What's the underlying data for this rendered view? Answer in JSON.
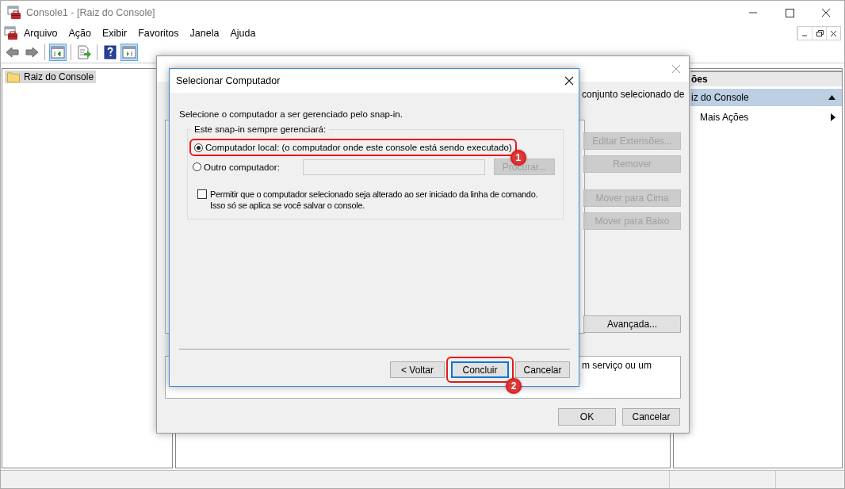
{
  "window": {
    "title": "Console1 - [Raiz do Console]"
  },
  "menu": [
    {
      "label": "Arquivo"
    },
    {
      "label": "Ação"
    },
    {
      "label": "Exibir"
    },
    {
      "label": "Favoritos"
    },
    {
      "label": "Janela"
    },
    {
      "label": "Ajuda"
    }
  ],
  "toolbar": [
    {
      "kind": "back",
      "pressed": false
    },
    {
      "kind": "forward",
      "pressed": false
    },
    {
      "kind": "separator"
    },
    {
      "kind": "tree",
      "pressed": true
    },
    {
      "kind": "separator"
    },
    {
      "kind": "export",
      "pressed": false
    },
    {
      "kind": "separator"
    },
    {
      "kind": "help",
      "pressed": false
    },
    {
      "kind": "actions",
      "pressed": true
    }
  ],
  "tree": [
    {
      "label": "Raiz do Console",
      "selected": true
    }
  ],
  "actions": {
    "header": "ões",
    "items": [
      {
        "kind": "section",
        "label": "iz do Console",
        "selected": true
      },
      {
        "kind": "submenu",
        "label": "Mais Ações",
        "selected": false
      }
    ]
  },
  "snapin_dialog": {
    "intro_fragment": "conjunto selecionado de",
    "buttons": [
      {
        "label": "Editar Extensões...",
        "disabled": true
      },
      {
        "label": "Remover",
        "disabled": true
      },
      {
        "label": "Mover para Cima",
        "disabled": true
      },
      {
        "label": "Mover para Baixo",
        "disabled": true
      },
      {
        "label": "Avançada...",
        "disabled": false
      }
    ],
    "description_fragment": "m serviço ou um",
    "footer_buttons": [
      {
        "label": "OK"
      },
      {
        "label": "Cancelar"
      }
    ]
  },
  "computer_dialog": {
    "title": "Selecionar Computador",
    "prompt": "Selecione o computador a ser gerenciado pelo snap-in.",
    "group_label": "Este snap-in sempre gerenciará:",
    "options": [
      {
        "label": "Computador local: (o computador onde este console está sendo executado)",
        "selected": true,
        "step": "1"
      },
      {
        "label": "Outro computador:",
        "selected": false
      }
    ],
    "computer_field": {
      "disabled": true
    },
    "browse_button": {
      "label": "Procurar...",
      "disabled": true
    },
    "allow_change": {
      "label": "Permitir que o computador selecionado seja alterado ao ser iniciado da linha de comando.\nIsso só se aplica se você salvar o console.",
      "checked": false
    },
    "buttons": [
      {
        "label": "< Voltar",
        "default": false
      },
      {
        "label": "Concluir",
        "default": true,
        "step": "2"
      },
      {
        "label": "Cancelar",
        "default": false
      }
    ]
  }
}
